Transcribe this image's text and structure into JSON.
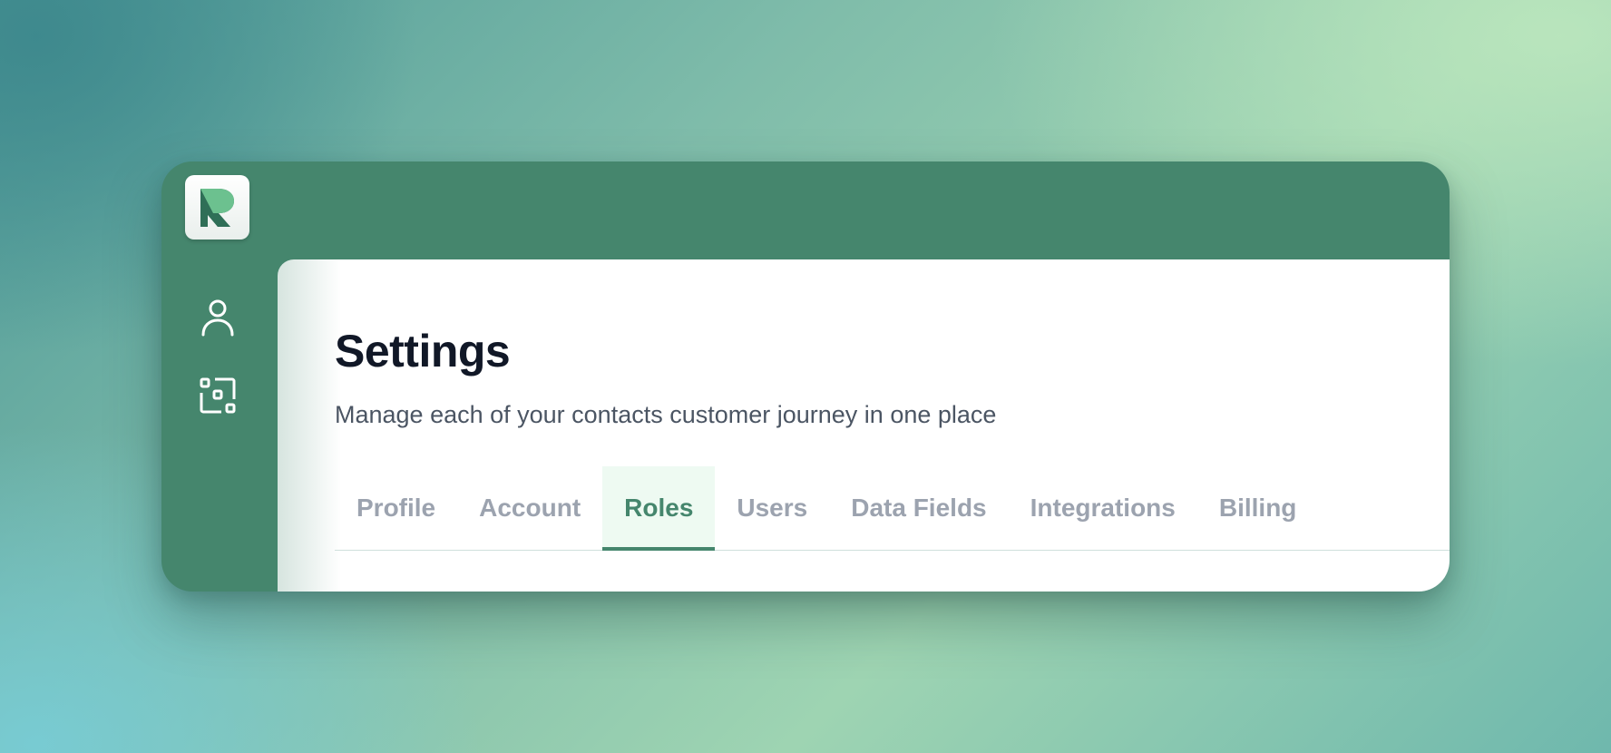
{
  "app": {
    "accent_color": "#45866d",
    "logo_icon": "r-logo-icon"
  },
  "sidebar": {
    "items": [
      {
        "icon": "user-icon"
      },
      {
        "icon": "scan-roles-icon"
      }
    ]
  },
  "header": {
    "title": "Settings",
    "subtitle": "Manage each of your contacts customer journey in one place"
  },
  "tabs": [
    {
      "label": "Profile",
      "active": false
    },
    {
      "label": "Account",
      "active": false
    },
    {
      "label": "Roles",
      "active": true
    },
    {
      "label": "Users",
      "active": false
    },
    {
      "label": "Data Fields",
      "active": false
    },
    {
      "label": "Integrations",
      "active": false
    },
    {
      "label": "Billing",
      "active": false
    }
  ]
}
